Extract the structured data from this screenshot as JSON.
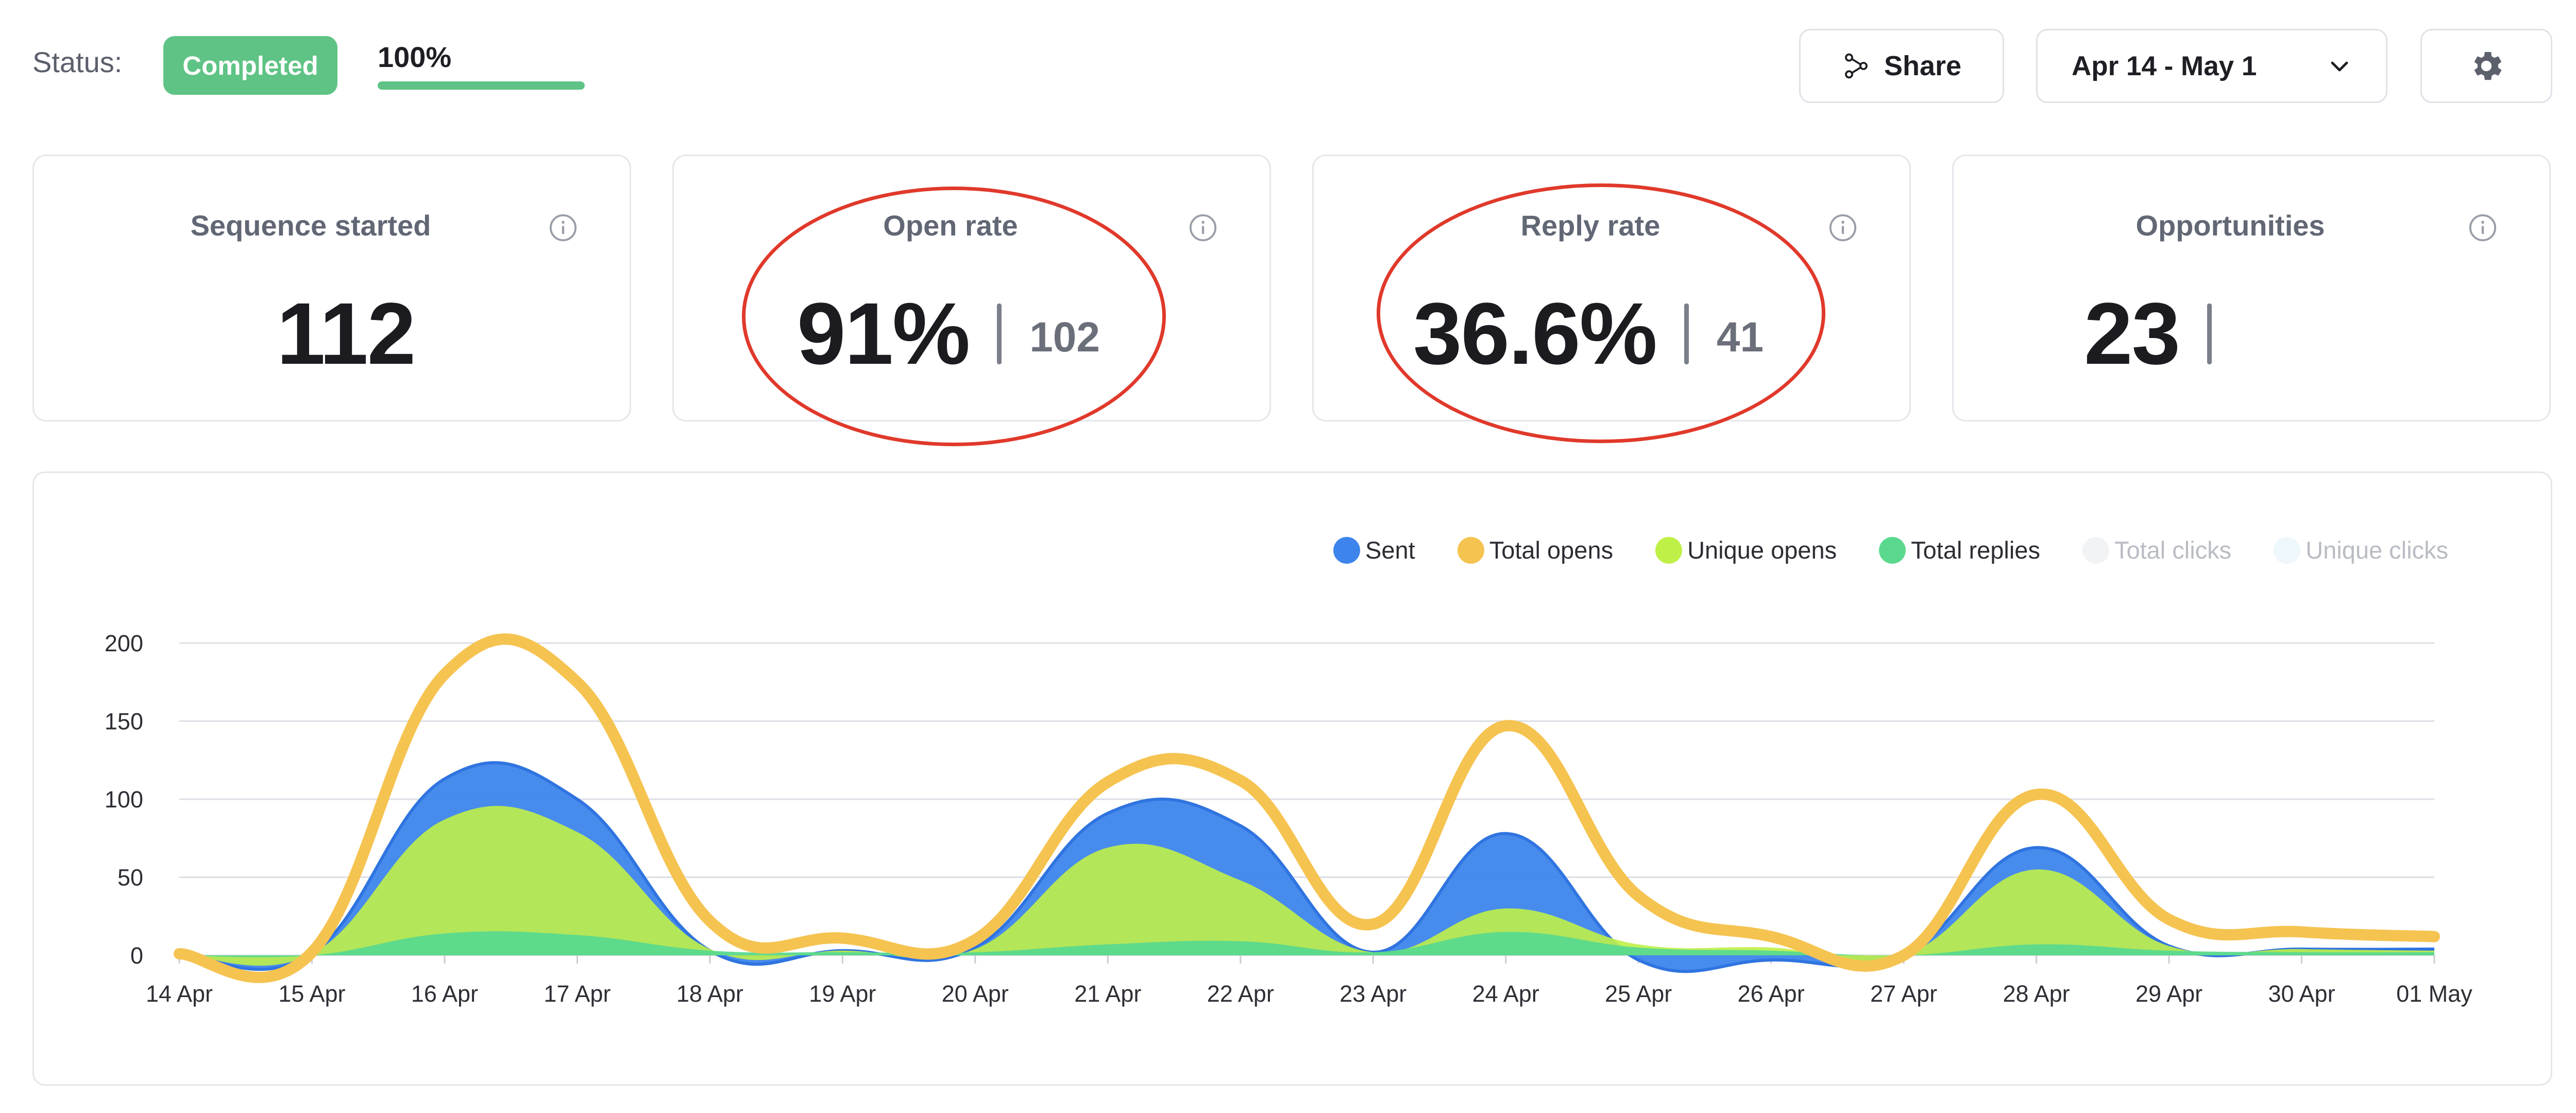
{
  "status": {
    "label": "Status:",
    "badge": "Completed",
    "progress_text": "100%",
    "progress_value": 100
  },
  "toolbar": {
    "share_label": "Share",
    "date_range": "Apr 14 - May 1"
  },
  "icons": {
    "share": "share-nodes-icon",
    "dropdown": "chevron-down-icon",
    "settings": "gear-icon",
    "info": "info-circle-icon"
  },
  "cards": [
    {
      "title": "Sequence started",
      "value": "112",
      "sub": ""
    },
    {
      "title": "Open rate",
      "value": "91%",
      "sub": "102"
    },
    {
      "title": "Reply rate",
      "value": "36.6%",
      "sub": "41"
    },
    {
      "title": "Opportunities",
      "value": "23",
      "sub": ""
    }
  ],
  "colors": {
    "accent": "#5ec385",
    "sent": "#3d85ec",
    "total_opens": "#f5c350",
    "unique_opens": "#bff047",
    "total_replies": "#5ad98e",
    "total_clicks": "#f1f3f5",
    "unique_clicks": "#eef7fb",
    "annotation": "#e0392b"
  },
  "chart_data": {
    "type": "area",
    "categories": [
      "14 Apr",
      "15 Apr",
      "16 Apr",
      "17 Apr",
      "18 Apr",
      "19 Apr",
      "20 Apr",
      "21 Apr",
      "22 Apr",
      "23 Apr",
      "24 Apr",
      "25 Apr",
      "26 Apr",
      "27 Apr",
      "28 Apr",
      "29 Apr",
      "30 Apr",
      "01 May"
    ],
    "ylim": [
      0,
      200
    ],
    "yticks": [
      0,
      50,
      100,
      150,
      200
    ],
    "grid": true,
    "legend_position": "top-right",
    "series": [
      {
        "name": "Sent",
        "values": [
          1,
          1,
          113,
          100,
          3,
          3,
          5,
          91,
          83,
          2,
          78,
          -3,
          -3,
          0,
          69,
          6,
          4,
          4
        ],
        "enabled": true
      },
      {
        "name": "Total opens",
        "values": [
          1,
          2,
          180,
          175,
          22,
          11,
          10,
          111,
          112,
          20,
          147,
          38,
          12,
          0,
          103,
          23,
          15,
          12
        ],
        "enabled": true
      },
      {
        "name": "Unique opens",
        "values": [
          1,
          1,
          87,
          79,
          4,
          3,
          4,
          69,
          48,
          2,
          30,
          7,
          5,
          0,
          55,
          6,
          4,
          3
        ],
        "enabled": true
      },
      {
        "name": "Total replies",
        "values": [
          0,
          0,
          14,
          13,
          3,
          2,
          2,
          7,
          9,
          2,
          15,
          5,
          3,
          0,
          7,
          3,
          2,
          2
        ],
        "enabled": true
      },
      {
        "name": "Total clicks",
        "values": [],
        "enabled": false
      },
      {
        "name": "Unique clicks",
        "values": [],
        "enabled": false
      }
    ]
  }
}
